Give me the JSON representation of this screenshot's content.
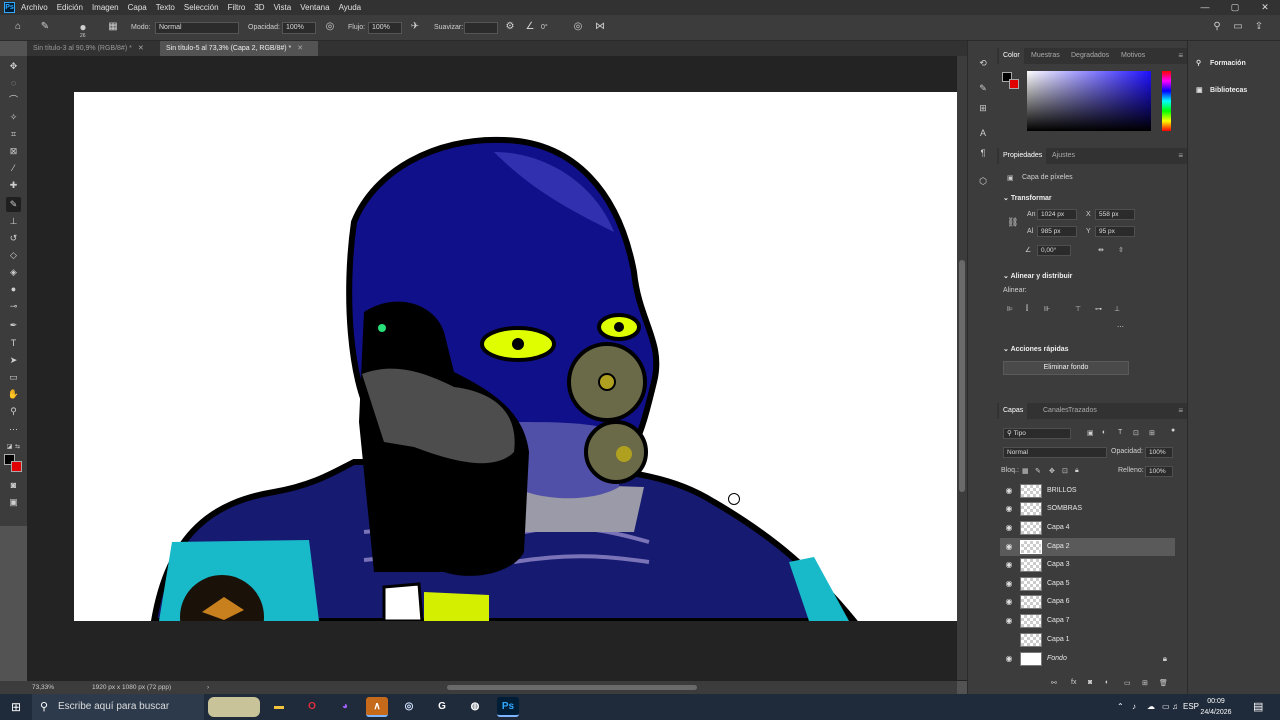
{
  "menu": [
    "Archivo",
    "Edición",
    "Imagen",
    "Capa",
    "Texto",
    "Selección",
    "Filtro",
    "3D",
    "Vista",
    "Ventana",
    "Ayuda"
  ],
  "app_logo": "Ps",
  "options_bar": {
    "brush_size": "26",
    "mode_label": "Modo:",
    "mode_value": "Normal",
    "opacity_label": "Opacidad:",
    "opacity_value": "100%",
    "flow_label": "Flujo:",
    "flow_value": "100%",
    "smoothing_label": "Suavizar:",
    "angle_value": "0°"
  },
  "doc_tabs": [
    {
      "label": "Sin título-3 al 90,9% (RGB/8#) *",
      "active": false
    },
    {
      "label": "Sin título-5 al 73,3% (Capa 2, RGB/8#) *",
      "active": true
    }
  ],
  "status": {
    "zoom": "73,33%",
    "doc_size": "1920 px x 1080 px (72 ppp)"
  },
  "color_panel": {
    "tabs": [
      "Color",
      "Muestras",
      "Degradados",
      "Motivos"
    ],
    "foreground": "#000000",
    "background": "#e00000"
  },
  "properties_panel": {
    "tabs": [
      "Propiedades",
      "Ajustes"
    ],
    "layer_kind": "Capa de píxeles",
    "transform_title": "Transformar",
    "w_label": "An",
    "w_value": "1024 px",
    "x_label": "X",
    "x_value": "558 px",
    "h_label": "Al",
    "h_value": "985 px",
    "y_label": "Y",
    "y_value": "95 px",
    "angle_value": "0,00°",
    "align_title": "Alinear y distribuir",
    "align_label": "Alinear:",
    "quick_actions_title": "Acciones rápidas",
    "remove_bg_button": "Eliminar fondo"
  },
  "layers_panel": {
    "tabs": [
      "Capas",
      "Canales",
      "Trazados"
    ],
    "filter_label": "Tipo",
    "blend_mode": "Normal",
    "opacity_label": "Opacidad:",
    "opacity_value": "100%",
    "lock_label": "Bloq.:",
    "fill_label": "Relleno:",
    "fill_value": "100%",
    "layers": [
      {
        "name": "BRILLOS",
        "visible": true,
        "selected": false
      },
      {
        "name": "SOMBRAS",
        "visible": true,
        "selected": false
      },
      {
        "name": "Capa 4",
        "visible": true,
        "selected": false
      },
      {
        "name": "Capa 2",
        "visible": true,
        "selected": true
      },
      {
        "name": "Capa 3",
        "visible": true,
        "selected": false
      },
      {
        "name": "Capa 5",
        "visible": true,
        "selected": false
      },
      {
        "name": "Capa 6",
        "visible": true,
        "selected": false
      },
      {
        "name": "Capa 7",
        "visible": true,
        "selected": false
      },
      {
        "name": "Capa 1",
        "visible": false,
        "selected": false
      },
      {
        "name": "Fondo",
        "visible": true,
        "selected": false,
        "locked": true
      }
    ]
  },
  "far_panel": {
    "items": [
      "Formación",
      "Bibliotecas"
    ]
  },
  "taskbar": {
    "search_placeholder": "Escribe aquí para buscar",
    "language": "ESP",
    "time": "00:09",
    "date": "24/4/2026"
  }
}
